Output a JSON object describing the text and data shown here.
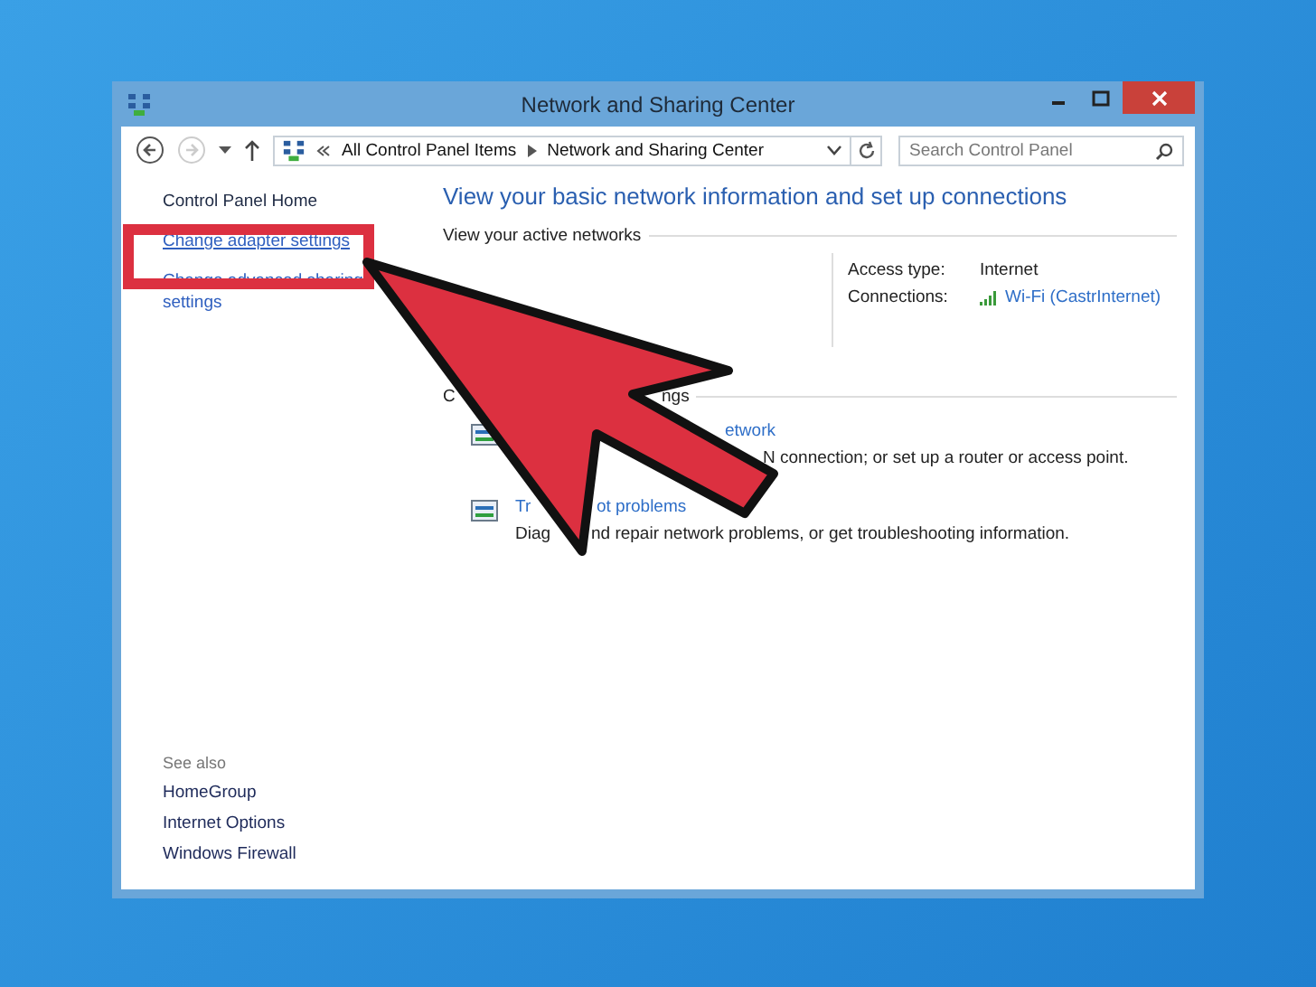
{
  "window": {
    "title": "Network and Sharing Center"
  },
  "address_bar": {
    "crumbs": [
      "All Control Panel Items",
      "Network and Sharing Center"
    ]
  },
  "search": {
    "placeholder": "Search Control Panel"
  },
  "sidebar": {
    "items": [
      {
        "label": "Control Panel Home",
        "kind": "plain",
        "highlighted": false
      },
      {
        "label": "Change adapter settings",
        "kind": "link",
        "highlighted": true
      },
      {
        "label": "Change advanced sharing settings",
        "kind": "link",
        "highlighted": false
      }
    ],
    "see_also_title": "See also",
    "see_also": [
      "HomeGroup",
      "Internet Options",
      "Windows Firewall"
    ]
  },
  "heading": "View your basic network information and set up connections",
  "active_networks": {
    "title": "View your active networks",
    "access_type_label": "Access type:",
    "access_type": "Internet",
    "connections_label": "Connections:",
    "connection": "Wi-Fi (CastrInternet)"
  },
  "networking_settings": {
    "title_lead": "C",
    "title_tail": "ngs",
    "items": [
      {
        "title_tail": "etwork",
        "desc_tail": "N connection; or set up a router or access point."
      },
      {
        "title_lead": "Tr",
        "title_tail": "ot problems",
        "desc_lead": "Diag",
        "desc_tail": "nd repair network problems, or get troubleshooting information."
      }
    ]
  }
}
